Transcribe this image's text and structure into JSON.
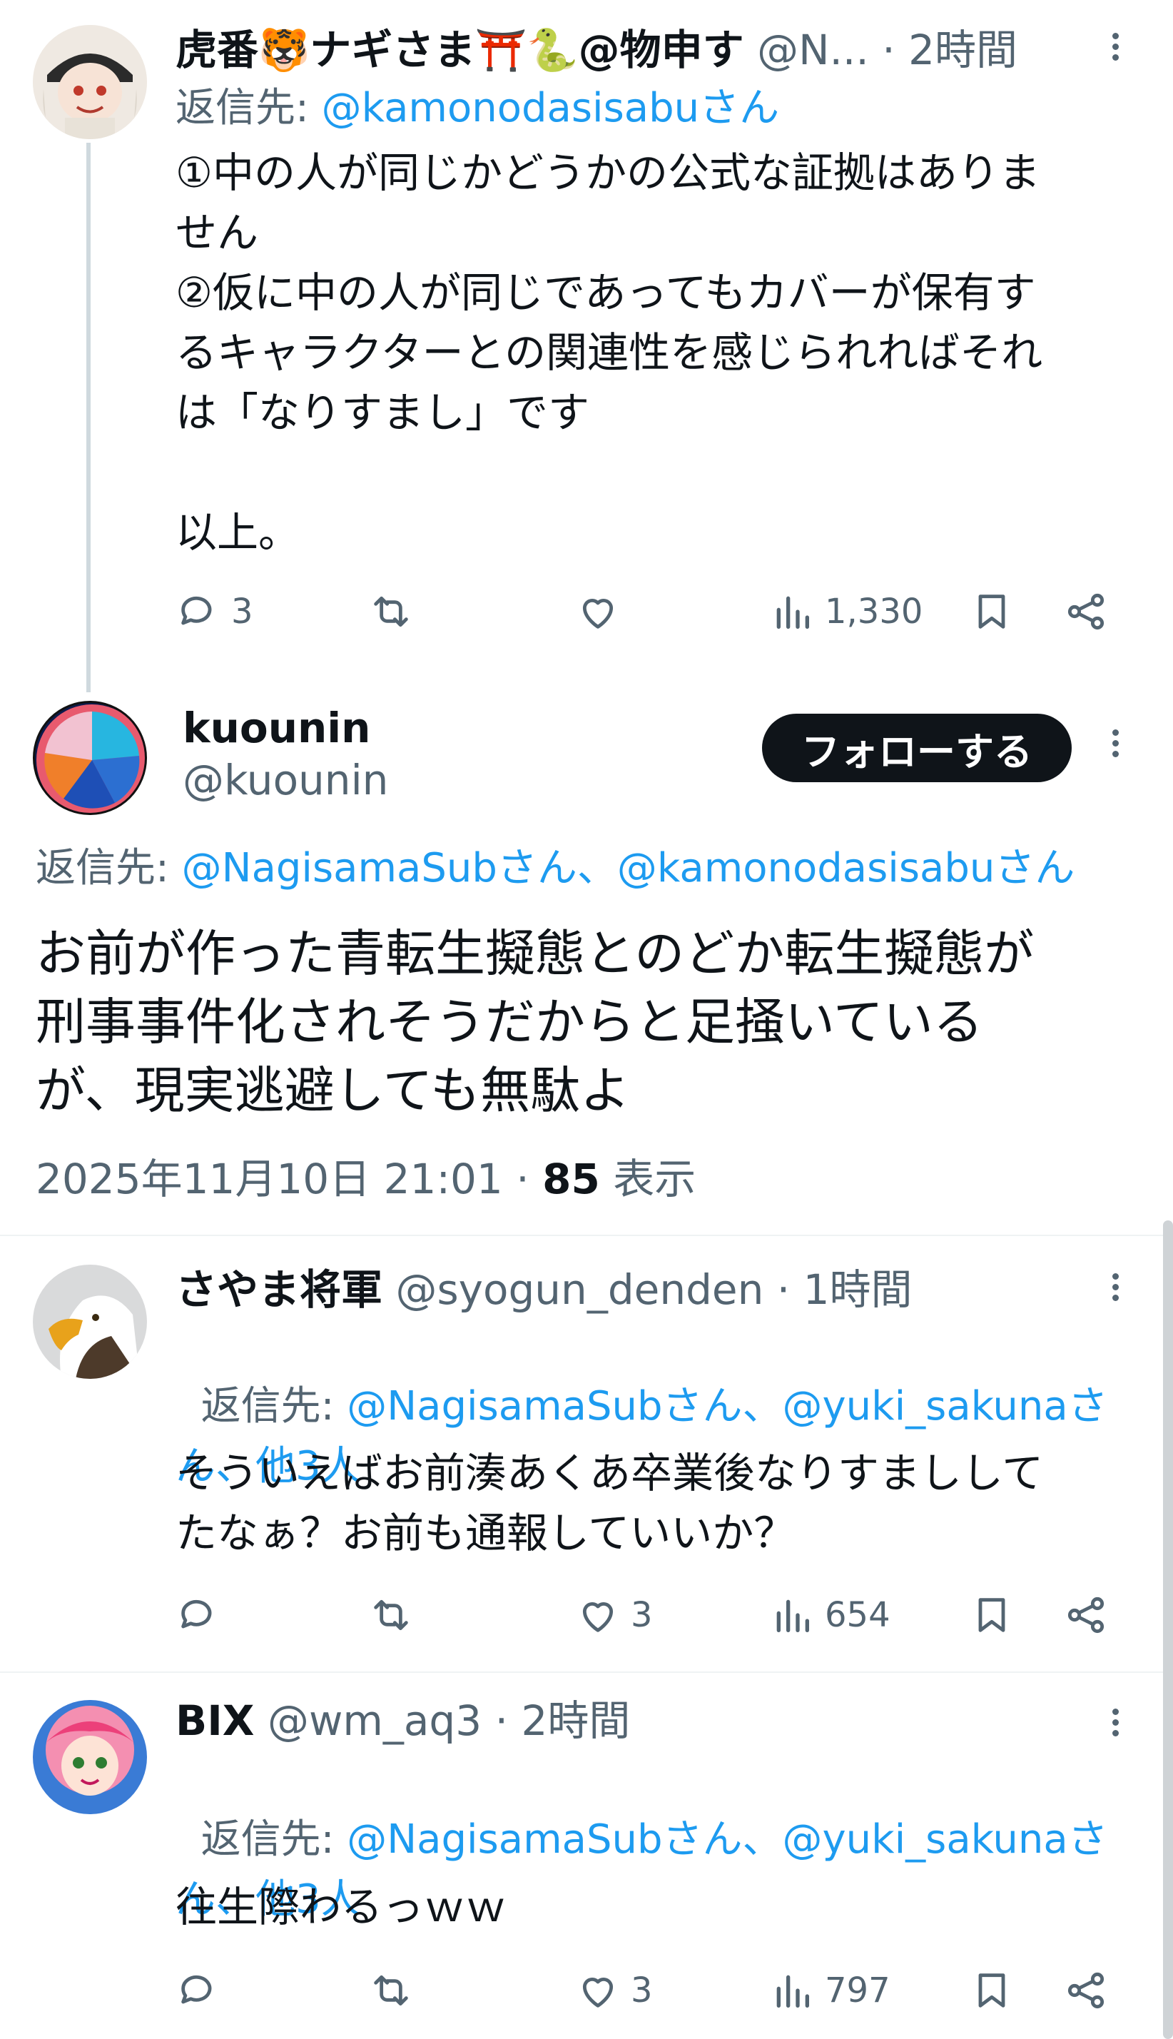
{
  "tweets": [
    {
      "name": "虎番🐯ナギさま⛩️🐍@物申す",
      "handle": "@N...",
      "time": "2時間",
      "reply_prefix": "返信先: ",
      "reply_mentions": "@kamonodasisabuさん",
      "text": "①中の人が同じかどうかの公式な証拠はありま\nせん\n②仮に中の人が同じであってもカバーが保有す\nるキャラクターとの関連性を感じられればそれ\nは「なりすまし」です\n\n以上。",
      "replies": "3",
      "retweets": "",
      "likes": "",
      "views": "1,330"
    },
    {
      "name": "さやま将軍",
      "handle": "@syogun_denden",
      "time": "1時間",
      "reply_prefix": "返信先: ",
      "reply_mentions": "@NagisamaSubさん、@yuki_sakunaさ\nん、他3人",
      "text": "そういえばお前湊あくあ卒業後なりすましして\nたなぁ？お前も通報していいか？",
      "replies": "",
      "retweets": "",
      "likes": "3",
      "views": "654"
    },
    {
      "name": "BIX",
      "handle": "@wm_aq3",
      "time": "2時間",
      "reply_prefix": "返信先: ",
      "reply_mentions": "@NagisamaSubさん、@yuki_sakunaさ\nん、他3人",
      "text": "往生際わるっｗｗ",
      "replies": "",
      "retweets": "",
      "likes": "3",
      "views": "797"
    }
  ],
  "main_tweet": {
    "name": "kuounin",
    "handle": "@kuounin",
    "follow_label": "フォローする",
    "reply_prefix": "返信先: ",
    "reply_mentions": "@NagisamaSubさん、@kamonodasisabuさん",
    "text": "お前が作った青転生擬態とのどか転生擬態が\n刑事事件化されそうだからと足掻いている\nが、現実逃避しても無駄よ",
    "date": "2025年11月10日 21:01 · ",
    "views_count": "85",
    "views_label": " 表示"
  },
  "separator": " · ",
  "colors": {
    "accent": "#1d9bf0",
    "text": "#0f1419",
    "muted": "#536471",
    "button": "#0f1419"
  }
}
